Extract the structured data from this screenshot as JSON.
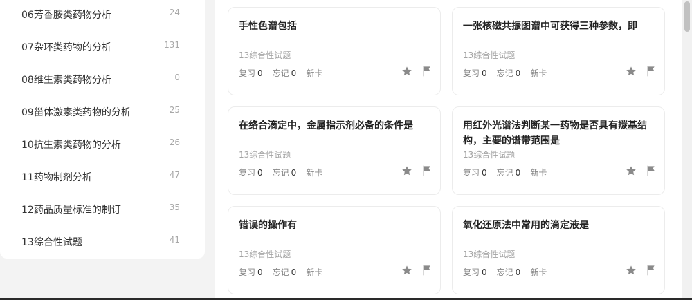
{
  "sidebar": {
    "items": [
      {
        "label": "06芳香胺类药物分析",
        "count": "24"
      },
      {
        "label": "07杂环类药物的分析",
        "count": "131"
      },
      {
        "label": "08维生素类药物分析",
        "count": "0"
      },
      {
        "label": "09甾体激素类药物的分析",
        "count": "25"
      },
      {
        "label": "10抗生素类药物的分析",
        "count": "26"
      },
      {
        "label": "11药物制剂分析",
        "count": "47"
      },
      {
        "label": "12药品质量标准的制订",
        "count": "35"
      },
      {
        "label": "13综合性试题",
        "count": "41"
      }
    ]
  },
  "cards": [
    {
      "title": "手性色谱包括",
      "tag": "13综合性试题",
      "review_label": "复习",
      "review_count": "0",
      "forget_label": "忘记",
      "forget_count": "0",
      "new_label": "新卡"
    },
    {
      "title": "一张核磁共振图谱中可获得三种参数，即",
      "tag": "13综合性试题",
      "review_label": "复习",
      "review_count": "0",
      "forget_label": "忘记",
      "forget_count": "0",
      "new_label": "新卡"
    },
    {
      "title": "在络合滴定中，金属指示剂必备的条件是",
      "tag": "13综合性试题",
      "review_label": "复习",
      "review_count": "0",
      "forget_label": "忘记",
      "forget_count": "0",
      "new_label": "新卡"
    },
    {
      "title": "用红外光谱法判断某一药物是否具有羰基结构，主要的谱带范围是",
      "tag": "13综合性试题",
      "review_label": "复习",
      "review_count": "0",
      "forget_label": "忘记",
      "forget_count": "0",
      "new_label": "新卡"
    },
    {
      "title": "错误的操作有",
      "tag": "13综合性试题",
      "review_label": "复习",
      "review_count": "0",
      "forget_label": "忘记",
      "forget_count": "0",
      "new_label": "新卡"
    },
    {
      "title": "氧化还原法中常用的滴定液是",
      "tag": "13综合性试题",
      "review_label": "复习",
      "review_count": "0",
      "forget_label": "忘记",
      "forget_count": "0",
      "new_label": "新卡"
    }
  ],
  "icons": {
    "star": "star-icon",
    "flag": "flag-icon"
  },
  "colors": {
    "icon": "#8a8a8a",
    "accent_text": "#222222",
    "muted": "#a3a3a3"
  }
}
